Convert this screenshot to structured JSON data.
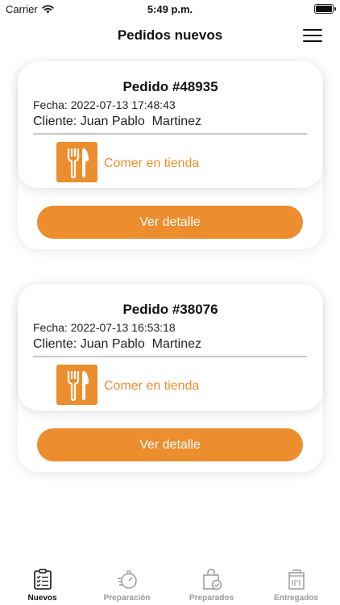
{
  "status_bar": {
    "carrier": "Carrier",
    "time": "5:49 p.m."
  },
  "nav": {
    "title": "Pedidos nuevos",
    "menu_icon": "hamburger-menu-icon"
  },
  "orders": [
    {
      "title": "Pedido #48935",
      "date": "Fecha: 2022-07-13 17:48:43",
      "client": "Cliente: Juan Pablo  Martinez",
      "service_icon": "fork-knife-icon",
      "service": "Comer en tienda",
      "button": "Ver detalle"
    },
    {
      "title": "Pedido #38076",
      "date": "Fecha: 2022-07-13 16:53:18",
      "client": "Cliente: Juan Pablo  Martinez",
      "service_icon": "fork-knife-icon",
      "service": "Comer en tienda",
      "button": "Ver detalle"
    }
  ],
  "tabs": [
    {
      "label": "Nuevos",
      "icon": "clipboard-checklist-icon",
      "active": true
    },
    {
      "label": "Preparación",
      "icon": "stopwatch-icon",
      "active": false
    },
    {
      "label": "Preparados",
      "icon": "bag-check-icon",
      "active": false
    },
    {
      "label": "Entregados",
      "icon": "delivery-box-icon",
      "active": false
    }
  ],
  "colors": {
    "accent": "#ec8e2e",
    "tab_inactive": "#9a9a9a",
    "tab_active": "#111111"
  }
}
